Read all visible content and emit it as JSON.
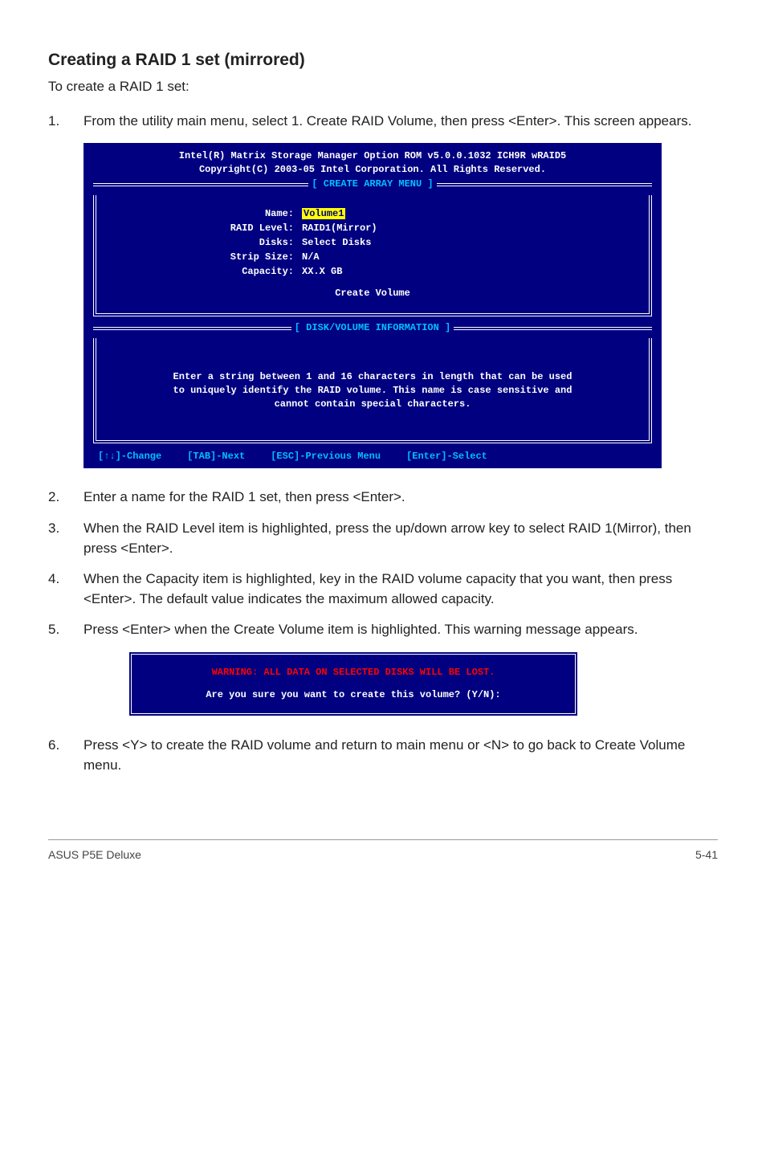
{
  "heading": "Creating a RAID 1 set (mirrored)",
  "intro": "To create a RAID 1 set:",
  "steps": {
    "s1": {
      "num": "1.",
      "text": "From the utility main menu, select 1. Create RAID Volume, then press <Enter>. This screen appears."
    },
    "s2": {
      "num": "2.",
      "text": "Enter a name for the RAID 1 set, then press <Enter>."
    },
    "s3": {
      "num": "3.",
      "text": "When the RAID Level item is highlighted, press the up/down arrow key to select RAID 1(Mirror), then press <Enter>."
    },
    "s4": {
      "num": "4.",
      "text": "When the Capacity item is highlighted, key in the RAID volume capacity that you want, then press <Enter>. The default value indicates the maximum allowed capacity."
    },
    "s5": {
      "num": "5.",
      "text": "Press <Enter> when the Create Volume item is highlighted. This warning message appears."
    },
    "s6": {
      "num": "6.",
      "text": "Press <Y> to create the RAID volume and return to main menu or <N> to go back to Create Volume menu."
    }
  },
  "bios": {
    "title1": "Intel(R) Matrix Storage Manager Option ROM v5.0.0.1032 ICH9R wRAID5",
    "title2": "Copyright(C) 2003-05 Intel Corporation. All Rights Reserved.",
    "menu_label": "[ CREATE ARRAY MENU ]",
    "fields": {
      "name": {
        "label": "Name:",
        "value": "Volume1"
      },
      "level": {
        "label": "RAID Level:",
        "value": "RAID1(Mirror)"
      },
      "disks": {
        "label": "Disks:",
        "value": "Select Disks"
      },
      "strip": {
        "label": "Strip Size:",
        "value": "N/A"
      },
      "cap": {
        "label": "Capacity:",
        "value": "XX.X  GB"
      }
    },
    "create_volume": "Create Volume",
    "dv_label": "[ DISK/VOLUME INFORMATION ]",
    "hint1": "Enter a string between 1 and 16 characters in length that can be used",
    "hint2": "to uniquely identify the RAID volume. This name is case sensitive and",
    "hint3": "cannot contain special characters.",
    "footer": {
      "change": "[↑↓]-Change",
      "next": "[TAB]-Next",
      "prev": "[ESC]-Previous Menu",
      "select": "[Enter]-Select"
    }
  },
  "warn": {
    "red": "WARNING: ALL DATA ON SELECTED DISKS WILL BE LOST.",
    "white": "Are you sure you want to create this volume? (Y/N):"
  },
  "footer": {
    "left": "ASUS P5E Deluxe",
    "right": "5-41"
  }
}
